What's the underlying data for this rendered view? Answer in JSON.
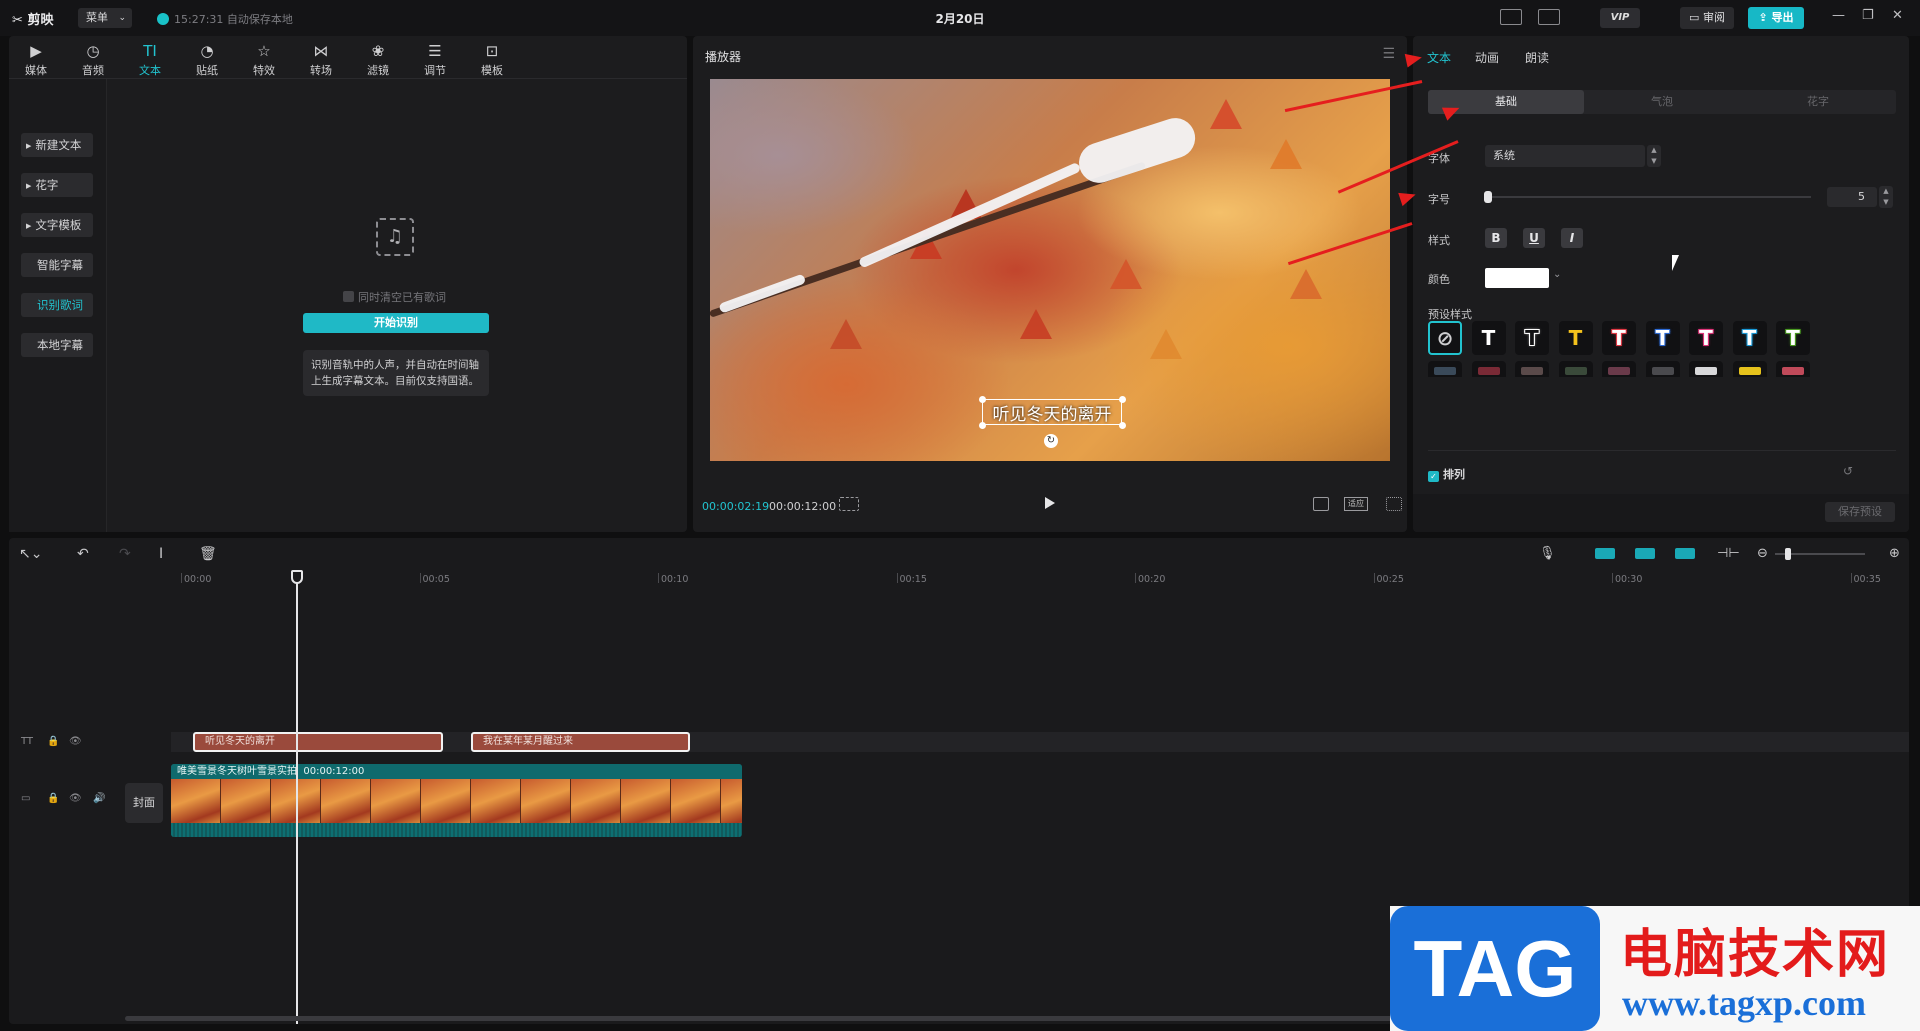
{
  "app": {
    "name": "剪映",
    "menu_label": "菜单",
    "autosave": "15:27:31 自动保存本地",
    "doc_title": "2月20日",
    "vip": "VIP",
    "review": "审阅",
    "export": "导出"
  },
  "toolbar": {
    "tabs": [
      {
        "label": "媒体",
        "icon": "media-icon"
      },
      {
        "label": "音频",
        "icon": "audio-icon"
      },
      {
        "label": "文本",
        "icon": "text-icon",
        "active": true
      },
      {
        "label": "贴纸",
        "icon": "sticker-icon"
      },
      {
        "label": "特效",
        "icon": "effects-icon"
      },
      {
        "label": "转场",
        "icon": "transition-icon"
      },
      {
        "label": "滤镜",
        "icon": "filter-icon"
      },
      {
        "label": "调节",
        "icon": "adjust-icon"
      },
      {
        "label": "模板",
        "icon": "template-icon"
      }
    ]
  },
  "sidebar": {
    "items": [
      {
        "label": "新建文本"
      },
      {
        "label": "花字"
      },
      {
        "label": "文字模板"
      },
      {
        "label": "智能字幕"
      },
      {
        "label": "识别歌词",
        "active": true
      },
      {
        "label": "本地字幕"
      }
    ]
  },
  "lyrics": {
    "clear_existing": "同时清空已有歌词",
    "start_button": "开始识别",
    "tip": "识别音轨中的人声，并自动在时间轴上生成字幕文本。目前仅支持国语。"
  },
  "player": {
    "title": "播放器",
    "caption": "听见冬天的离开",
    "current_time": "00:00:02:19",
    "total_time": "00:00:12:00",
    "ratio": "适应"
  },
  "props": {
    "tabs": [
      "文本",
      "动画",
      "朗读"
    ],
    "subtabs": [
      "基础",
      "气泡",
      "花字"
    ],
    "font_label": "字体",
    "font_value": "系统",
    "size_label": "字号",
    "size_value": "5",
    "size_level": 0.0,
    "style_label": "样式",
    "styles": [
      "B",
      "U",
      "I"
    ],
    "color_label": "颜色",
    "color_value": "#ffffff",
    "preset_label": "预设样式",
    "presets": [
      {
        "glyph": "⃠",
        "color": "#cfcfd1",
        "selected": true
      },
      {
        "glyph": "T",
        "color": "#ffffff"
      },
      {
        "glyph": "T",
        "color": "#111113",
        "outline": "#ffffff"
      },
      {
        "glyph": "T",
        "color": "#f4c21c"
      },
      {
        "glyph": "T",
        "color": "#ffffff",
        "outline": "#e23a46"
      },
      {
        "glyph": "T",
        "color": "#ffffff",
        "outline": "#2d6bd6"
      },
      {
        "glyph": "T",
        "color": "#ffffff",
        "outline": "#e0357a"
      },
      {
        "glyph": "T",
        "color": "#ffffff",
        "outline": "#1a9ad8"
      },
      {
        "glyph": "T",
        "color": "#ffffff",
        "outline": "#4a9a22"
      }
    ],
    "arrange_label": "排列",
    "save_preset": "保存预设"
  },
  "timeline": {
    "ruler": [
      "00:00",
      "00:05",
      "00:10",
      "00:15",
      "00:20",
      "00:25",
      "00:30",
      "00:35"
    ],
    "text_clips": [
      "听见冬天的离开",
      "我在某年某月醒过来"
    ],
    "video_clip_name": "唯美雪景冬天树叶雪景实拍",
    "video_clip_duration": "00:00:12:00",
    "cover": "封面"
  },
  "watermark": {
    "tag": "TAG",
    "cn": "电脑技术网",
    "url": "www.tagxp.com"
  },
  "colors": {
    "accent": "#22c3cf",
    "text_clip": "#9a4a3c",
    "video_clip": "#0f5a5c",
    "annotation": "#e51e1e"
  }
}
